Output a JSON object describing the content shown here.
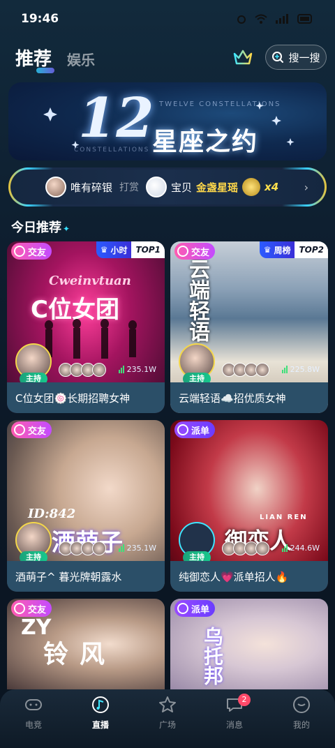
{
  "status": {
    "time": "19:46"
  },
  "header": {
    "tabs": [
      {
        "label": "推荐"
      },
      {
        "label": "娱乐"
      }
    ],
    "search_label": "搜一搜"
  },
  "banner": {
    "number": "12",
    "title": "星座之约",
    "sub1": "TWELVE CONSTELLATIONS",
    "sub2": "CONSTELLATIONS"
  },
  "marquee": {
    "user": "唯有碎银",
    "action": "打赏",
    "target": "宝贝",
    "gift": "金盏星瑶",
    "count": "x4"
  },
  "section": {
    "title": "今日推荐"
  },
  "cards": [
    {
      "tag": "交友",
      "rank_period": "小时",
      "rank": "TOP1",
      "host": "主持",
      "heat": "235.1W",
      "title": "C位女团🍥长期招聘女神",
      "deco": "C位女团",
      "deco2": "Cweinvtuan"
    },
    {
      "tag": "交友",
      "rank_period": "周榜",
      "rank": "TOP2",
      "host": "主持",
      "heat": "225.8W",
      "title": "云端轻语☁️招优质女神",
      "deco": "云端轻语"
    },
    {
      "tag": "交友",
      "host": "主持",
      "heat": "235.1W",
      "title": "酒萌子^ 暮光牌朝露水",
      "deco": "酒萌子",
      "deco2": "ID:842"
    },
    {
      "tag": "派单",
      "host": "主持",
      "heat": "244.6W",
      "title": "纯御恋人💗派单招人🔥",
      "deco": "御恋人",
      "deco2": "LIAN REN"
    },
    {
      "tag": "交友",
      "deco": "风铃",
      "deco2": "ZY"
    },
    {
      "tag": "派单",
      "deco": "乌托邦"
    }
  ],
  "nav": {
    "items": [
      {
        "label": "电竞",
        "icon": "gamepad-icon"
      },
      {
        "label": "直播",
        "icon": "music-note-icon"
      },
      {
        "label": "广场",
        "icon": "plaza-icon"
      },
      {
        "label": "消息",
        "icon": "message-icon",
        "badge": "2"
      },
      {
        "label": "我的",
        "icon": "profile-icon"
      }
    ]
  }
}
